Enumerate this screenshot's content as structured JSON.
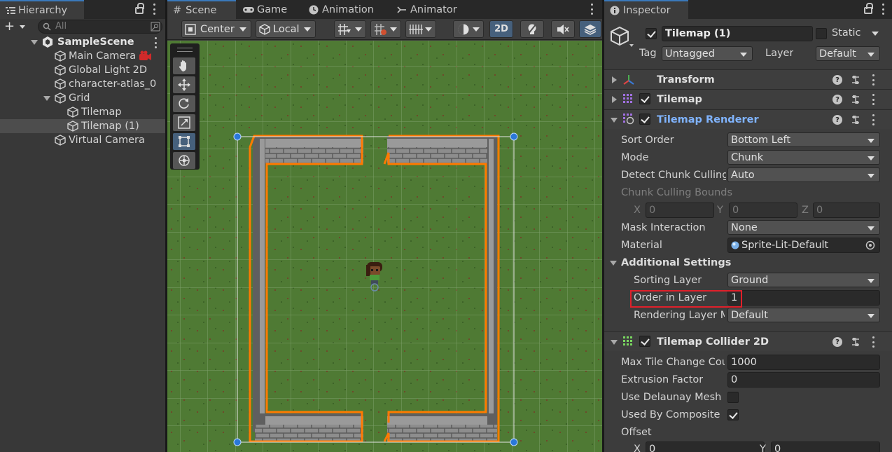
{
  "hierarchy": {
    "tab_label": "Hierarchy",
    "search_placeholder": "All",
    "scene_name": "SampleScene",
    "items": [
      {
        "label": "Main Camera"
      },
      {
        "label": "Global Light 2D"
      },
      {
        "label": "character-atlas_0"
      },
      {
        "label": "Grid"
      },
      {
        "label": "Tilemap"
      },
      {
        "label": "Tilemap (1)"
      },
      {
        "label": "Virtual Camera"
      }
    ]
  },
  "scene": {
    "tabs": [
      {
        "label": "Scene"
      },
      {
        "label": "Game"
      },
      {
        "label": "Animation"
      },
      {
        "label": "Animator"
      }
    ],
    "toolbar": {
      "pivot_label": "Center",
      "space_label": "Local",
      "mode_2d_label": "2D"
    },
    "tools": [
      "hand-tool",
      "move-tool",
      "rotate-tool",
      "scale-tool",
      "rect-tool",
      "transform-tool"
    ],
    "grass_color": "#4f7a34",
    "outline_color": "#ff7a00"
  },
  "inspector": {
    "tab_label": "Inspector",
    "object_name": "Tilemap (1)",
    "static_label": "Static",
    "tag_label": "Tag",
    "tag_value": "Untagged",
    "layer_label": "Layer",
    "layer_value": "Default",
    "components": {
      "transform": "Transform",
      "tilemap": "Tilemap",
      "renderer": "Tilemap Renderer",
      "collider": "Tilemap Collider 2D"
    },
    "renderer": {
      "sort_order_label": "Sort Order",
      "sort_order_value": "Bottom Left",
      "mode_label": "Mode",
      "mode_value": "Chunk",
      "detect_culling_label": "Detect Chunk Culling",
      "detect_culling_value": "Auto",
      "culling_bounds_label": "Chunk Culling Bounds",
      "x_label": "X",
      "x_value": "0",
      "y_label": "Y",
      "y_value": "0",
      "z_label": "Z",
      "z_value": "0",
      "mask_label": "Mask Interaction",
      "mask_value": "None",
      "material_label": "Material",
      "material_value": "Sprite-Lit-Default",
      "additional_label": "Additional Settings",
      "sorting_layer_label": "Sorting Layer",
      "sorting_layer_value": "Ground",
      "order_label": "Order in Layer",
      "order_value": "1",
      "rendering_mask_label": "Rendering Layer Mask",
      "rendering_mask_value": "Default"
    },
    "collider": {
      "max_tile_label": "Max Tile Change Count",
      "max_tile_value": "1000",
      "extrusion_label": "Extrusion Factor",
      "extrusion_value": "0",
      "delaunay_label": "Use Delaunay Mesh",
      "composite_label": "Used By Composite",
      "offset_label": "Offset",
      "offset_x_label": "X",
      "offset_x_value": "0",
      "offset_y_label": "Y",
      "offset_y_value": "0"
    },
    "highlight_color": "#e0202a"
  }
}
